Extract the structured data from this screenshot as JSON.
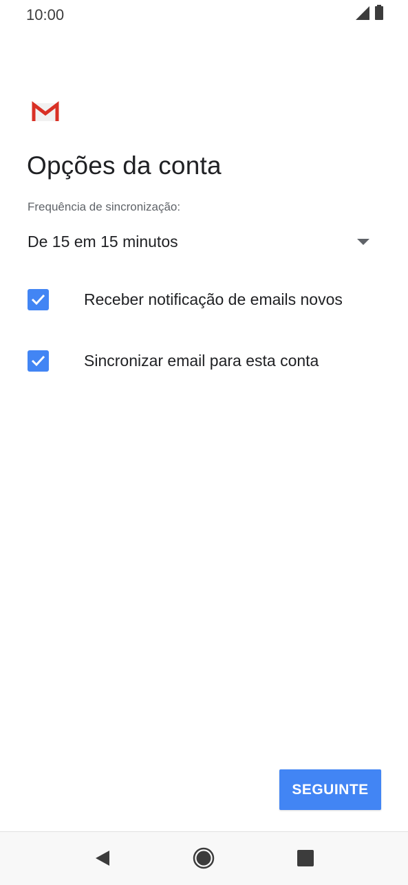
{
  "status_bar": {
    "time": "10:00",
    "icons": [
      "signal-icon",
      "battery-icon"
    ]
  },
  "app": {
    "logo_icon": "gmail-logo-icon"
  },
  "page": {
    "title": "Opções da conta"
  },
  "sync": {
    "label": "Frequência de sincronização:",
    "selected_value": "De 15 em 15 minutos"
  },
  "options": [
    {
      "label": "Receber notificação de emails novos",
      "checked": true
    },
    {
      "label": "Sincronizar email para esta conta",
      "checked": true
    }
  ],
  "actions": {
    "next_label": "SEGUINTE"
  },
  "navigation": {
    "icons": [
      "back-icon",
      "home-icon",
      "recents-icon"
    ]
  },
  "colors": {
    "accent": "#4285f4",
    "gmail_red": "#d93025",
    "text_primary": "#202124",
    "text_secondary": "#5f6368"
  }
}
